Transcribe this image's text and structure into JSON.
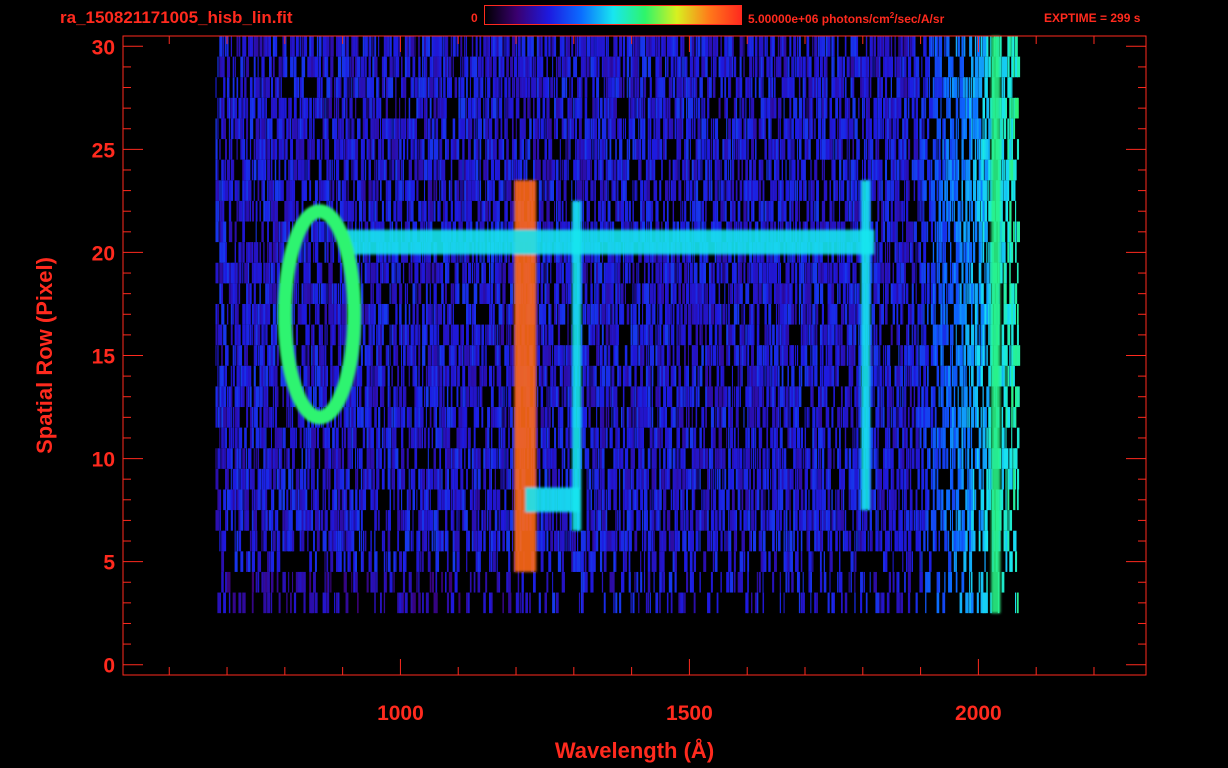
{
  "header": {
    "filename": "ra_150821171005_hisb_lin.fit",
    "colorbar_min": "0",
    "colorbar_max_value": "5.00000e+06 photons/cm",
    "colorbar_max_sup": "2",
    "colorbar_max_rest": "/sec/A/sr",
    "exptime": "EXPTIME = 299 s"
  },
  "colors": {
    "axis": "#ff2a1e",
    "background": "#000000",
    "colormap": [
      "#000000",
      "#3a0070",
      "#1d1ae0",
      "#0b6cff",
      "#18e6f0",
      "#2ef56a",
      "#d8f020",
      "#ff7a1a",
      "#ff2a1e"
    ]
  },
  "chart_data": {
    "type": "heatmap",
    "title": "ra_150821171005_hisb_lin.fit",
    "xlabel": "Wavelength (Å)",
    "ylabel": "Spatial Row (Pixel)",
    "xlim": [
      520,
      2290
    ],
    "ylim": [
      -0.5,
      30.5
    ],
    "x_ticks": [
      1000,
      1500,
      2000
    ],
    "y_ticks": [
      0,
      5,
      10,
      15,
      20,
      25,
      30
    ],
    "colorbar_range": [
      0,
      5000000
    ],
    "colorbar_unit": "photons/cm²/sec/A/sr",
    "exptime_s": 299,
    "grid": false,
    "features": {
      "vertical_bands": [
        {
          "x": 1216,
          "ymin": 5,
          "ymax": 23,
          "intensity": 0.9
        },
        {
          "x": 1305,
          "ymin": 7,
          "ymax": 22,
          "intensity": 0.5
        },
        {
          "x": 1805,
          "ymin": 8,
          "ymax": 23,
          "intensity": 0.5
        },
        {
          "x": 2030,
          "ymin": 3,
          "ymax": 30,
          "intensity": 0.6
        }
      ],
      "horizontal_bands": [
        {
          "y": 20.5,
          "xmin": 900,
          "xmax": 1820,
          "intensity": 0.5
        },
        {
          "y": 8,
          "xmin": 1216,
          "xmax": 1310,
          "intensity": 0.5
        }
      ],
      "ring": {
        "cx": 860,
        "cy": 17,
        "rx": 60,
        "ry": 5,
        "intensity": 0.62
      }
    }
  }
}
